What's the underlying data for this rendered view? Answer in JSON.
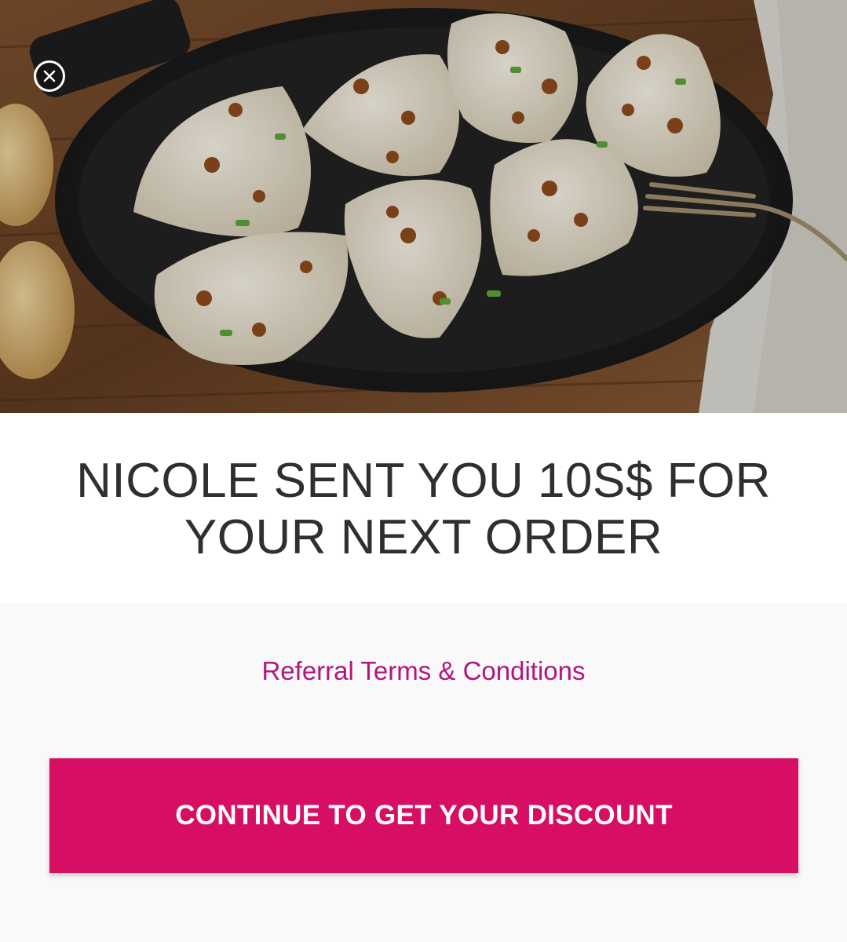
{
  "header_image": {
    "subject": "pierogi-photo"
  },
  "close": {
    "icon": "close-circle-icon"
  },
  "referral": {
    "headline": "NICOLE SENT YOU 10S$ FOR YOUR NEXT ORDER",
    "terms_link": "Referral Terms & Conditions",
    "cta_label": "CONTINUE TO GET YOUR DISCOUNT"
  },
  "colors": {
    "brand_pink": "#d70f64",
    "link_pink": "#b0167d",
    "headline_text": "#2f2f2f",
    "panel_bg": "#f9f9f9"
  }
}
